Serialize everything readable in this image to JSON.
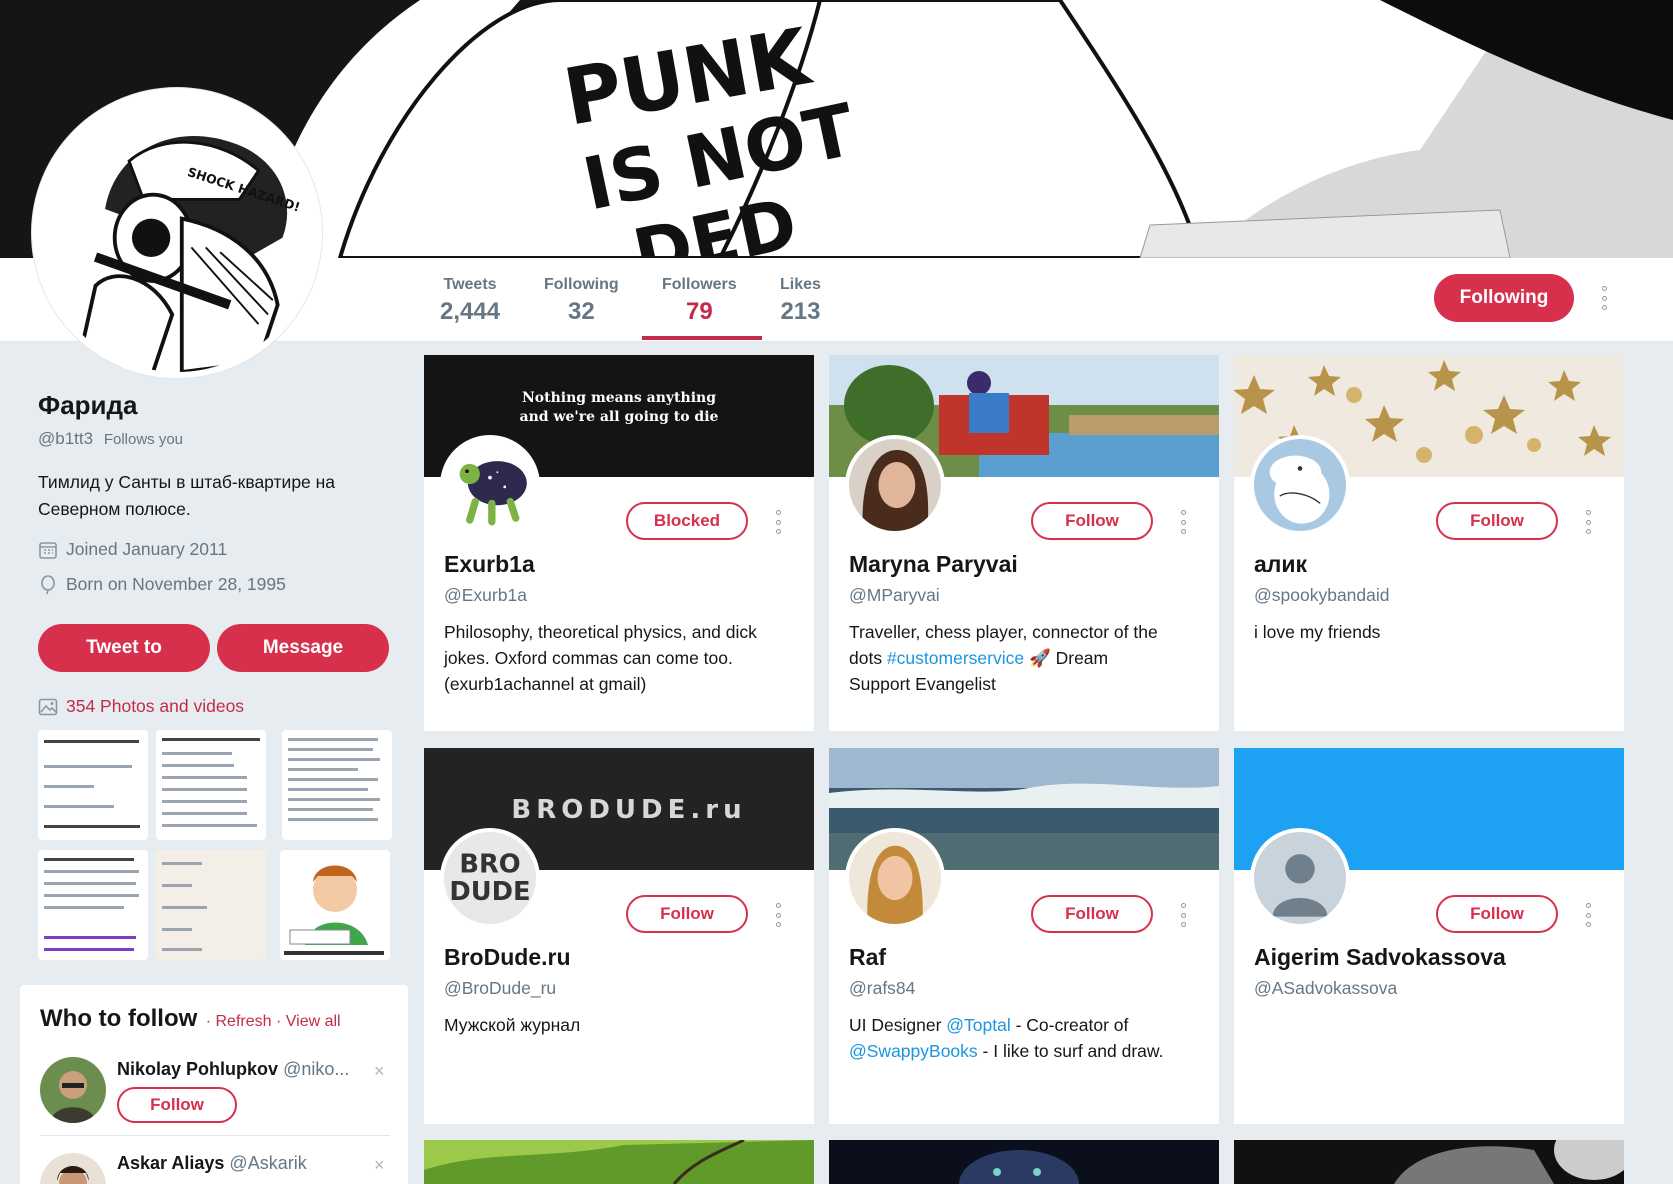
{
  "banner": {
    "shirt_text_1": "PUNK",
    "shirt_text_2": "IS NOT",
    "shirt_text_3": "DED"
  },
  "avatar": {
    "helmet_text": "SHOCK HAZARD!"
  },
  "nav": {
    "stats": [
      {
        "label": "Tweets",
        "value": "2,444"
      },
      {
        "label": "Following",
        "value": "32"
      },
      {
        "label": "Followers",
        "value": "79",
        "active": true
      },
      {
        "label": "Likes",
        "value": "213"
      }
    ],
    "following_button": "Following"
  },
  "profile": {
    "name": "Фарида",
    "handle": "@b1tt3",
    "follows_you": "Follows you",
    "bio_line1": "Тимлид у Санты в штаб-квартире на",
    "bio_line2": "Северном полюсе.",
    "joined": "Joined January 2011",
    "born": "Born on November 28, 1995",
    "tweet_to": "Tweet to",
    "message": "Message",
    "photos_link": "354 Photos and videos"
  },
  "who_to_follow": {
    "title": "Who to follow",
    "refresh": "Refresh",
    "view_all": "View all",
    "suggestions": [
      {
        "name": "Nikolay Pohlupkov",
        "handle": "@niko...",
        "follow": "Follow"
      },
      {
        "name": "Askar Aliays",
        "handle": "@Askarik"
      }
    ]
  },
  "cards": [
    {
      "cover_text_1": "Nothing means anything",
      "cover_text_2": "and we're all going to die",
      "button": "Blocked",
      "name": "Exurb1a",
      "handle": "@Exurb1a",
      "bio": [
        "Philosophy, theoretical physics, and dick",
        "jokes. Oxford commas can come too.",
        "(exurb1achannel at gmail)"
      ]
    },
    {
      "button": "Follow",
      "name": "Maryna Paryvai",
      "handle": "@MParyvai",
      "bio_1": "Traveller, chess player, connector of the",
      "bio_2a": "dots ",
      "bio_2_link": "#customerservice",
      "bio_2b": " 🚀 Dream",
      "bio_3": "Support Evangelist"
    },
    {
      "button": "Follow",
      "name": "алик",
      "handle": "@spookybandaid",
      "bio": [
        "i love my friends"
      ]
    },
    {
      "cover_text": "BRODUDE.ru",
      "avatar_text_1": "BRO",
      "avatar_text_2": "DUDE",
      "button": "Follow",
      "name": "BroDude.ru",
      "handle": "@BroDude_ru",
      "bio": [
        "Мужской журнал"
      ]
    },
    {
      "button": "Follow",
      "name": "Raf",
      "handle": "@rafs84",
      "bio_1a": "UI Designer ",
      "bio_1_link": "@Toptal",
      "bio_1b": " - Co-creator of",
      "bio_2_link": "@SwappyBooks",
      "bio_2b": " - I like to surf and draw."
    },
    {
      "button": "Follow",
      "name": "Aigerim Sadvokassova",
      "handle": "@ASadvokassova"
    }
  ],
  "colors": {
    "accent": "#d6304c",
    "link": "#1b95e0",
    "muted": "#657786",
    "background": "#e6ecf0"
  }
}
